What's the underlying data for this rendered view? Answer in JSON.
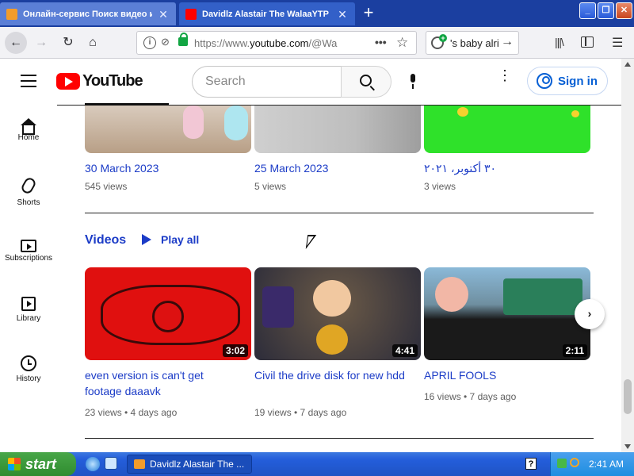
{
  "browser": {
    "tabs": [
      {
        "title": "Онлайн-сервис Поиск видео и со",
        "active": false
      },
      {
        "title": "Davidlz Alastair The WalaaYTP - Yo",
        "active": true
      }
    ],
    "url": {
      "prefix": "https://www.",
      "domain": "youtube.com",
      "suffix": "/@Wa"
    },
    "search_text": "'s baby alri"
  },
  "youtube": {
    "logo_text": "YouTube",
    "search_placeholder": "Search",
    "signin_label": "Sign in",
    "nav": [
      {
        "label": "Home",
        "icon": "home-icon"
      },
      {
        "label": "Shorts",
        "icon": "shorts-icon"
      },
      {
        "label": "Subscriptions",
        "icon": "subscriptions-icon"
      },
      {
        "label": "Library",
        "icon": "library-icon"
      },
      {
        "label": "History",
        "icon": "history-icon"
      }
    ],
    "top_row": [
      {
        "date": "30 March 2023",
        "views": "545 views"
      },
      {
        "date": "25 March 2023",
        "views": "5 views"
      },
      {
        "date": "٣٠ أكتوبر، ٢٠٢١",
        "views": "3 views"
      }
    ],
    "section": {
      "title": "Videos",
      "play_all": "Play all"
    },
    "videos": [
      {
        "title": "even version is can't get footage daaavk",
        "duration": "3:02",
        "meta": "23 views • 4 days ago"
      },
      {
        "title": "Civil the drive disk for new hdd",
        "duration": "4:41",
        "meta": "19 views • 7 days ago"
      },
      {
        "title": "APRIL FOOLS",
        "duration": "2:11",
        "meta": "16 views • 7 days ago"
      }
    ]
  },
  "taskbar": {
    "start_label": "start",
    "task_label": "Davidlz Alastair The ...",
    "clock": "2:41 AM"
  },
  "colors": {
    "xp_blue": "#245edb",
    "yt_red": "#ff0000",
    "link_blue": "#1c3cc7"
  }
}
